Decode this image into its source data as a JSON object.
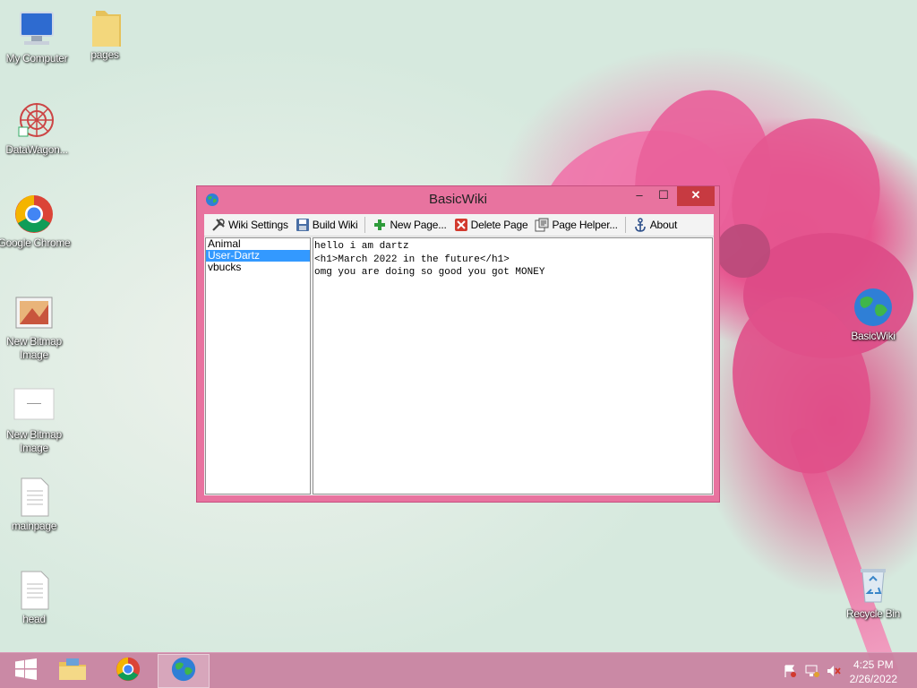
{
  "desktop": {
    "icons_left": [
      {
        "label": "My Computer",
        "icon": "computer-icon"
      },
      {
        "label": "pages",
        "icon": "folder-icon"
      },
      {
        "label": "DataWagon...",
        "icon": "datawagon-icon"
      },
      {
        "label": "Google Chrome",
        "icon": "chrome-icon"
      },
      {
        "label": "New Bitmap Image",
        "icon": "bitmap-icon"
      },
      {
        "label": "New Bitmap Image",
        "icon": "bitmap-blank-icon"
      },
      {
        "label": "mainpage",
        "icon": "document-icon"
      },
      {
        "label": "head",
        "icon": "document-icon"
      }
    ],
    "icons_right": [
      {
        "label": "BasicWiki",
        "icon": "globe-icon"
      },
      {
        "label": "Recycle Bin",
        "icon": "recycle-bin-icon"
      }
    ]
  },
  "window": {
    "title": "BasicWiki",
    "minimize": "–",
    "maximize": "☐",
    "close": "✕",
    "toolbar": {
      "wiki_settings": "Wiki Settings",
      "build_wiki": "Build Wiki",
      "new_page": "New Page...",
      "delete_page": "Delete Page",
      "page_helper": "Page Helper...",
      "about": "About"
    },
    "pages": [
      "Animal",
      "User-Dartz",
      "vbucks"
    ],
    "selected_page": "User-Dartz",
    "editor_lines": [
      "hello i am dartz",
      "<h1>March 2022 in the future</h1>",
      "omg you are doing so good you got MONEY"
    ]
  },
  "taskbar": {
    "time": "4:25 PM",
    "date": "2/26/2022"
  },
  "colors": {
    "window_frame": "#e8739f",
    "close_button": "#c73a41",
    "selection": "#3399ff",
    "taskbar": "#c980a0"
  }
}
